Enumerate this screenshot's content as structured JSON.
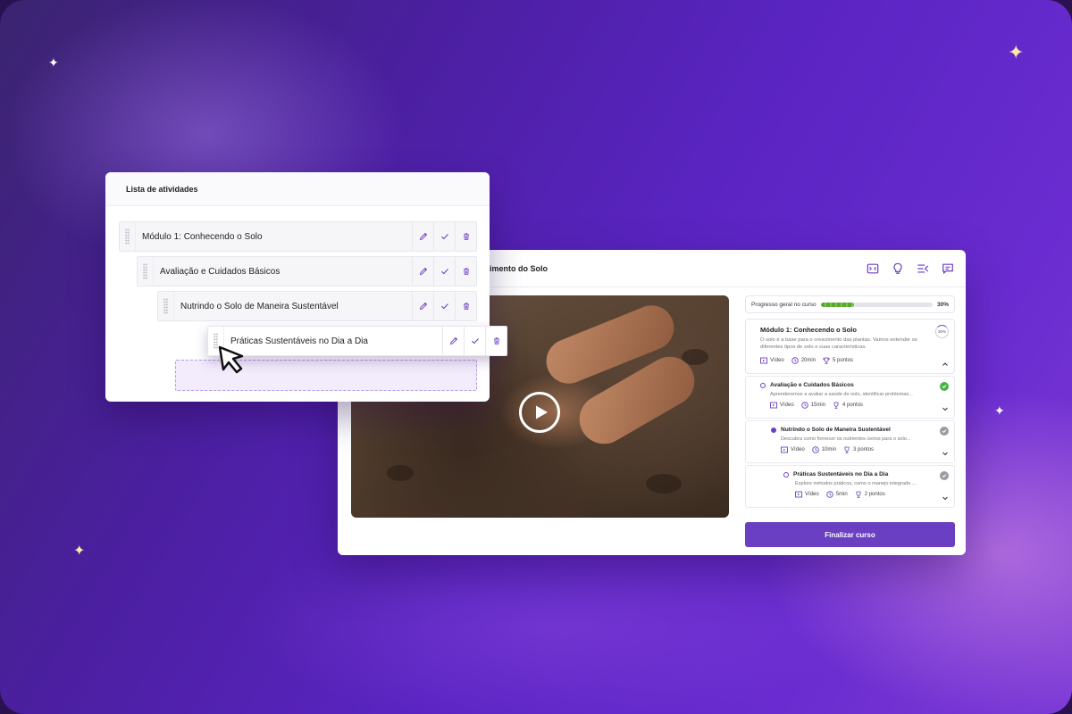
{
  "activities": {
    "title": "Lista de atividades",
    "items": [
      {
        "label": "Módulo 1: Conhecendo o Solo"
      },
      {
        "label": "Avaliação e Cuidados Básicos"
      },
      {
        "label": "Nutrindo o Solo de Maneira Sustentável"
      },
      {
        "label": "Práticas Sustentáveis no Dia a Dia"
      }
    ]
  },
  "player": {
    "title": "ecimento do Solo",
    "header_icons": [
      "expand-icon",
      "lightbulb-icon",
      "menu-collapse-icon",
      "chat-icon"
    ],
    "progress": {
      "label": "Progresso geral no curso",
      "value": 30,
      "value_label": "30%"
    },
    "module": {
      "title": "Módulo 1: Conhecendo o Solo",
      "description": "O solo é a base para o crescimento das plantas. Vamos entender os diferentes tipos de solo e suas características.",
      "ring_label": "30%",
      "type": "Vídeo",
      "duration": "20min",
      "points": "5 pontos"
    },
    "lessons": [
      {
        "title": "Avaliação e Cuidados Básicos",
        "description": "Aprenderemos a avaliar a saúde do solo, identificar problemas...",
        "type": "Vídeo",
        "duration": "15min",
        "points": "4 pontos",
        "status": "done"
      },
      {
        "title": "Nutrindo o Solo de Maneira Sustentável",
        "description": "Descubra como fornecer os nutrientes certos para o solo...",
        "type": "Vídeo",
        "duration": "10min",
        "points": "3 pontos",
        "status": "pending"
      },
      {
        "title": "Práticas Sustentáveis no Dia a Dia",
        "description": "Explore métodos práticos, como o manejo integrado ...",
        "type": "Vídeo",
        "duration": "5min",
        "points": "2 pontos",
        "status": "pending"
      }
    ],
    "finish_label": "Finalizar curso"
  },
  "colors": {
    "accent": "#6b3fc2",
    "success": "#45b34a",
    "background": "#5a24c2"
  }
}
